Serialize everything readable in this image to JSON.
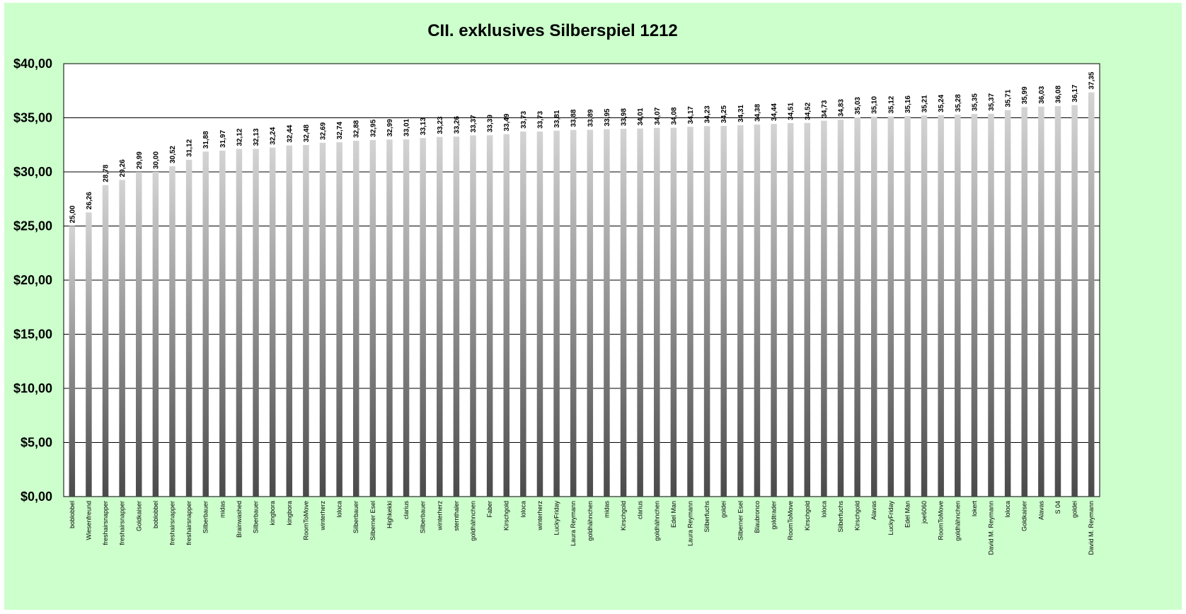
{
  "chart_data": {
    "type": "bar",
    "title": "CII. exklusives Silberspiel 1212",
    "xlabel": "",
    "ylabel": "",
    "ylim": [
      0,
      40
    ],
    "ytick_values": [
      0,
      5,
      10,
      15,
      20,
      25,
      30,
      35,
      40
    ],
    "ytick_labels": [
      "$0,00",
      "$5,00",
      "$10,00",
      "$15,00",
      "$20,00",
      "$25,00",
      "$30,00",
      "$35,00",
      "$40,00"
    ],
    "grid": true,
    "legend": "none",
    "categories": [
      "boblobbel",
      "Wiesenfreund",
      "freshairsnapper",
      "freshairsnapper",
      "Goldkaiser",
      "boblobbel",
      "freshairsnapper",
      "freshairsnapper",
      "Silberbauer",
      "midas",
      "Brainwashed",
      "Silberbauer",
      "kingbora",
      "kingbora",
      "RoomToMove",
      "winterherz",
      "loloca",
      "Silberbauer",
      "Silberner Esel",
      "Highkekki",
      "clarius",
      "Silberbauer",
      "winterherz",
      "sternthaler",
      "goldhähnchen",
      "Faber",
      "Kirschgold",
      "loloca",
      "winterherz",
      "LuckyFriday",
      "Laura Reymann",
      "goldhähnchen",
      "midas",
      "Kirschgold",
      "clarius",
      "goldhähnchen",
      "Edel Man",
      "Laura Reymann",
      "Silberfuchs",
      "goldei",
      "Silberner Esel",
      "Blaubronco",
      "goldtrader",
      "RoomToMove",
      "Kirschgold",
      "loloca",
      "Silberfuchs",
      "Kirschgold",
      "Alavas",
      "LuckyFriday",
      "Edel Man",
      "joe6060",
      "RoomToMove",
      "goldhähnchen",
      "lokert",
      "David M. Reymann",
      "loloca",
      "Goldkaiser",
      "Alavas",
      "S 04",
      "goldei",
      "David M. Reymann"
    ],
    "values": [
      25.0,
      26.26,
      28.78,
      29.26,
      29.99,
      30.0,
      30.52,
      31.12,
      31.88,
      31.97,
      32.12,
      32.13,
      32.24,
      32.44,
      32.48,
      32.69,
      32.74,
      32.88,
      32.95,
      32.99,
      33.01,
      33.13,
      33.23,
      33.26,
      33.37,
      33.39,
      33.49,
      33.73,
      33.73,
      33.81,
      33.88,
      33.89,
      33.95,
      33.98,
      34.01,
      34.07,
      34.08,
      34.17,
      34.23,
      34.25,
      34.31,
      34.38,
      34.44,
      34.51,
      34.52,
      34.73,
      34.83,
      35.03,
      35.1,
      35.12,
      35.16,
      35.21,
      35.24,
      35.28,
      35.35,
      35.37,
      35.71,
      35.99,
      36.03,
      36.08,
      36.17,
      37.35
    ],
    "data_labels": [
      "25,00",
      "26,26",
      "28,78",
      "29,26",
      "29,99",
      "30,00",
      "30,52",
      "31,12",
      "31,88",
      "31,97",
      "32,12",
      "32,13",
      "32,24",
      "32,44",
      "32,48",
      "32,69",
      "32,74",
      "32,88",
      "32,95",
      "32,99",
      "33,01",
      "33,13",
      "33,23",
      "33,26",
      "33,37",
      "33,39",
      "33,49",
      "33,73",
      "33,73",
      "33,81",
      "33,88",
      "33,89",
      "33,95",
      "33,98",
      "34,01",
      "34,07",
      "34,08",
      "34,17",
      "34,23",
      "34,25",
      "34,31",
      "34,38",
      "34,44",
      "34,51",
      "34,52",
      "34,73",
      "34,83",
      "35,03",
      "35,10",
      "35,12",
      "35,16",
      "35,21",
      "35,24",
      "35,28",
      "35,35",
      "35,37",
      "35,71",
      "35,99",
      "36,03",
      "36,08",
      "36,17",
      "37,35"
    ],
    "colors": {
      "background": "#ccffcc",
      "plot_area": "#ffffff",
      "bar_light": "#d4d4d4",
      "bar_dark": "#4a4a4a",
      "gridline": "#000000"
    }
  }
}
